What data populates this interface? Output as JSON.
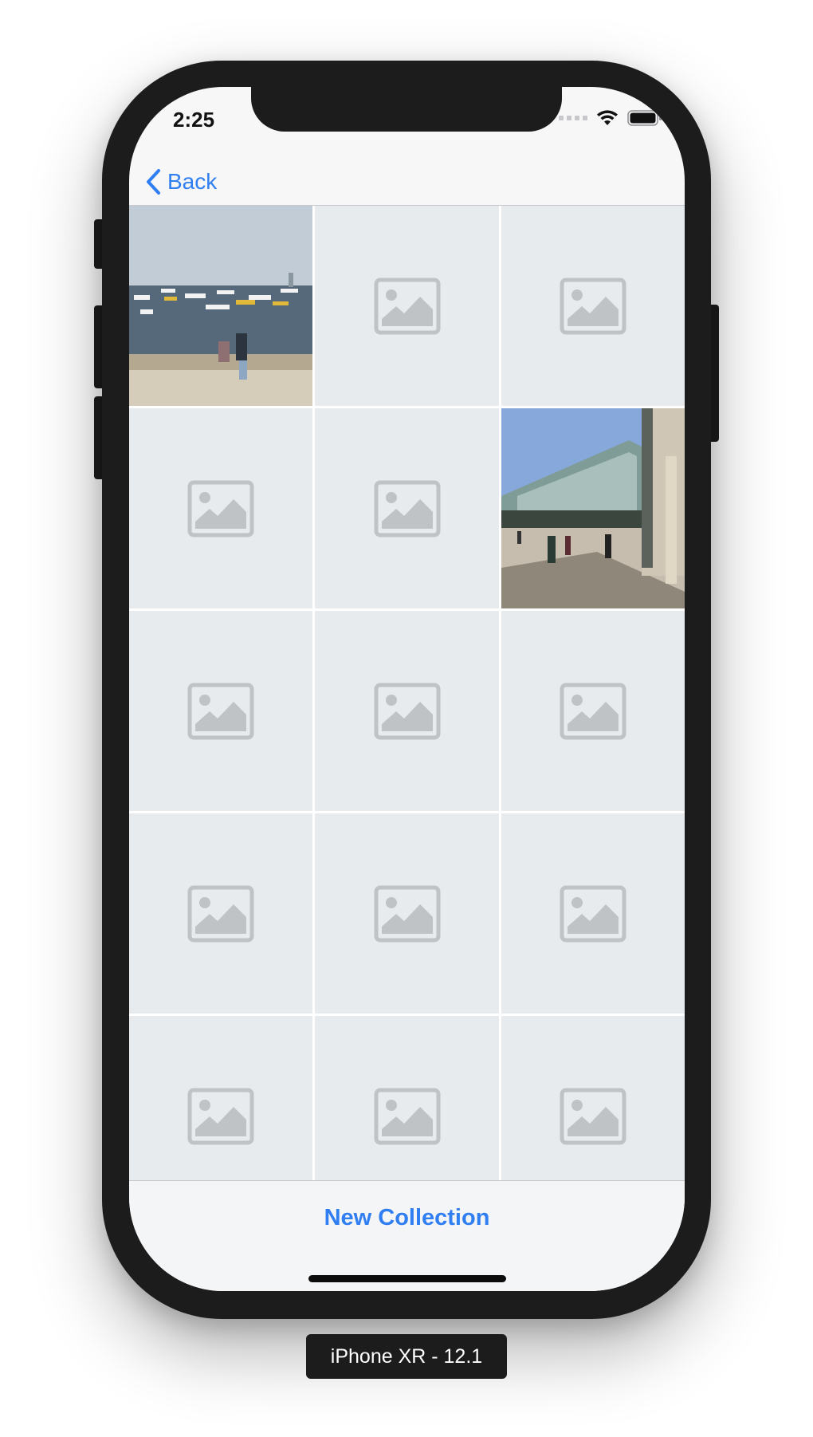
{
  "status_bar": {
    "time": "2:25"
  },
  "nav": {
    "back_label": "Back"
  },
  "grid": {
    "cells": [
      {
        "type": "photo",
        "icon": "photo-harbor"
      },
      {
        "type": "placeholder",
        "icon": "image-placeholder-icon"
      },
      {
        "type": "placeholder",
        "icon": "image-placeholder-icon"
      },
      {
        "type": "placeholder",
        "icon": "image-placeholder-icon"
      },
      {
        "type": "placeholder",
        "icon": "image-placeholder-icon"
      },
      {
        "type": "photo",
        "icon": "photo-terminal"
      },
      {
        "type": "placeholder",
        "icon": "image-placeholder-icon"
      },
      {
        "type": "placeholder",
        "icon": "image-placeholder-icon"
      },
      {
        "type": "placeholder",
        "icon": "image-placeholder-icon"
      },
      {
        "type": "placeholder",
        "icon": "image-placeholder-icon"
      },
      {
        "type": "placeholder",
        "icon": "image-placeholder-icon"
      },
      {
        "type": "placeholder",
        "icon": "image-placeholder-icon"
      },
      {
        "type": "placeholder",
        "icon": "image-placeholder-icon"
      },
      {
        "type": "placeholder",
        "icon": "image-placeholder-icon"
      },
      {
        "type": "placeholder",
        "icon": "image-placeholder-icon"
      }
    ]
  },
  "toolbar": {
    "new_collection_label": "New Collection"
  },
  "device_label": "iPhone XR - 12.1",
  "colors": {
    "accent": "#2f7ef2",
    "placeholder_bg": "#e8ebee",
    "placeholder_icon": "#c0c3c6",
    "device_frame": "#1c1c1c"
  }
}
